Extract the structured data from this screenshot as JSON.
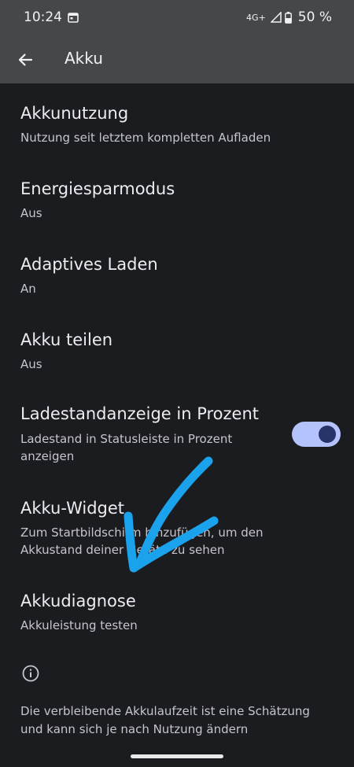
{
  "status_bar": {
    "time": "10:24",
    "network": "4G+",
    "battery_percent": "50 %",
    "icons": [
      "calendar-icon",
      "signal-icon",
      "battery-icon"
    ]
  },
  "app_bar": {
    "title": "Akku",
    "back_icon": "arrow-back-icon"
  },
  "items": [
    {
      "title": "Akkunutzung",
      "subtitle": "Nutzung seit letztem kompletten Aufladen"
    },
    {
      "title": "Energiesparmodus",
      "subtitle": "Aus"
    },
    {
      "title": "Adaptives Laden",
      "subtitle": "An"
    },
    {
      "title": "Akku teilen",
      "subtitle": "Aus"
    },
    {
      "title": "Ladestandanzeige in Prozent",
      "subtitle_line1": "Ladestand in Statusleiste in Prozent",
      "subtitle_line2": "anzeigen",
      "toggle_on": true
    },
    {
      "title": "Akku-Widget",
      "subtitle_line1": "Zum Startbildschirm hinzufügen, um den",
      "subtitle_line2": "Akkustand deiner Geräte zu sehen"
    },
    {
      "title": "Akkudiagnose",
      "subtitle": "Akkuleistung testen"
    }
  ],
  "footer": {
    "icon": "info-icon",
    "line1": "Die verbleibende Akkulaufzeit ist eine Schätzung",
    "line2": "und kann sich je nach Nutzung ändern"
  },
  "colors": {
    "background": "#1b1c20",
    "app_bar": "#45474b",
    "toggle_track": "#b4c3fb",
    "toggle_knob": "#27346a",
    "annotation_arrow": "#1aa3ec"
  }
}
